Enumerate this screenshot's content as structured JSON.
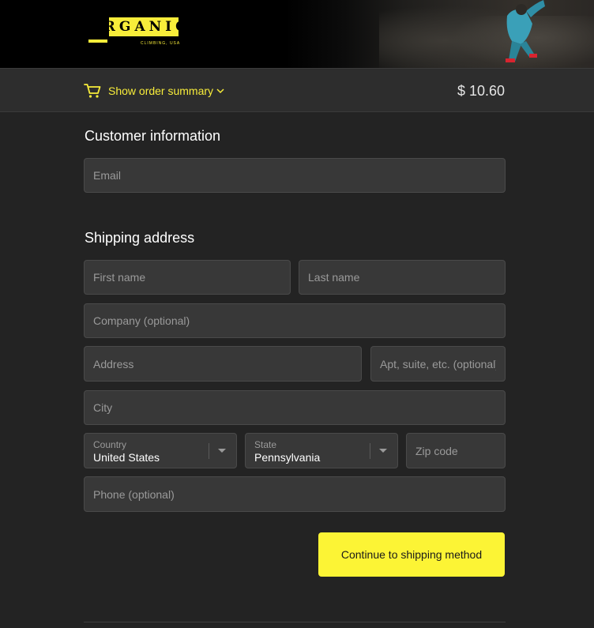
{
  "brand": {
    "logo_text": "ORGANIC",
    "logo_subtext": "CLIMBING, USA",
    "accent_color": "#f8ed3a"
  },
  "summary": {
    "toggle_label": "Show order summary",
    "total": "$ 10.60",
    "cart_icon": "cart-icon",
    "chevron_icon": "chevron-down-icon"
  },
  "customer": {
    "heading": "Customer information",
    "email_placeholder": "Email"
  },
  "shipping": {
    "heading": "Shipping address",
    "first_name_placeholder": "First name",
    "last_name_placeholder": "Last name",
    "company_placeholder": "Company (optional)",
    "address_placeholder": "Address",
    "apt_placeholder": "Apt, suite, etc. (optional)",
    "city_placeholder": "City",
    "country_label": "Country",
    "country_value": "United States",
    "state_label": "State",
    "state_value": "Pennsylvania",
    "zip_placeholder": "Zip code",
    "phone_placeholder": "Phone (optional)"
  },
  "actions": {
    "continue_label": "Continue to shipping method"
  }
}
